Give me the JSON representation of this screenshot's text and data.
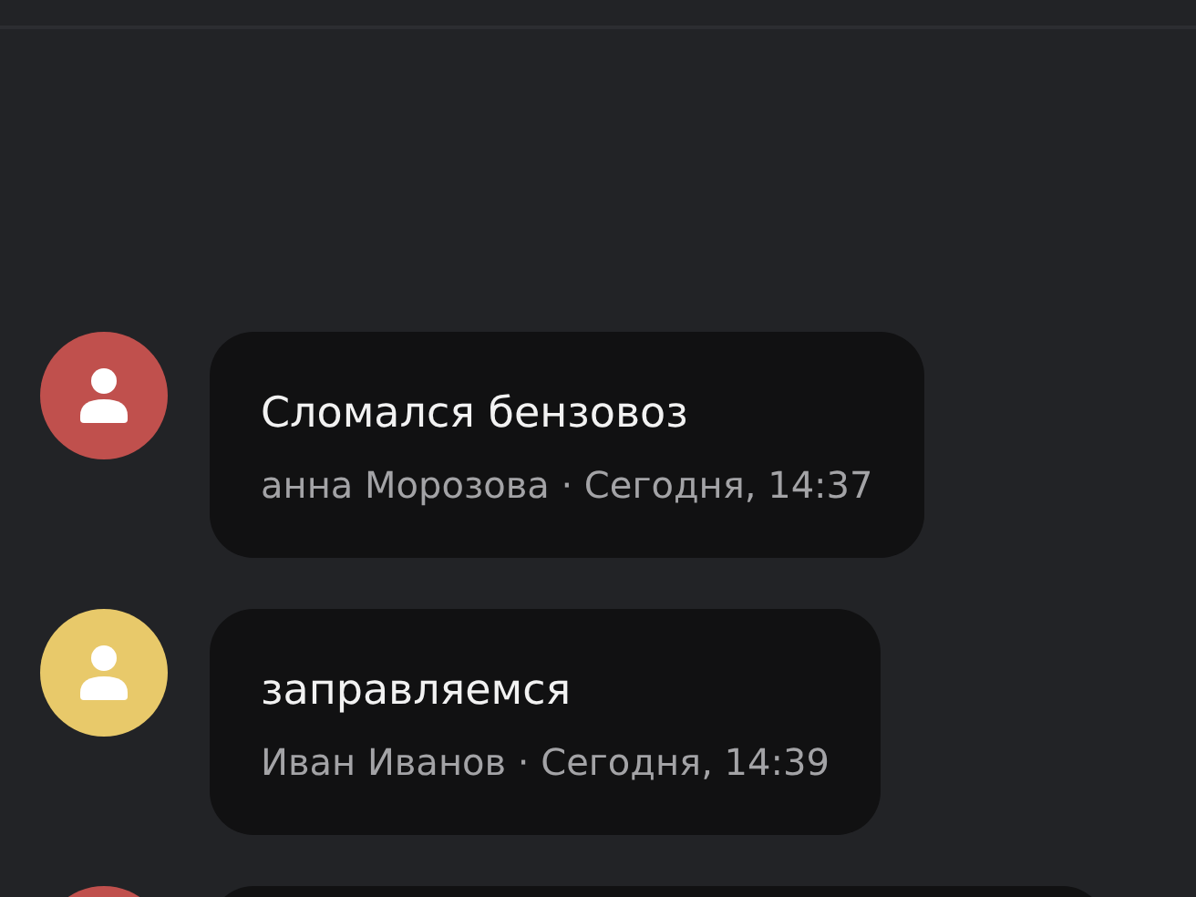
{
  "messages": [
    {
      "color": "#c0504d",
      "text": "Сломался бензовоз",
      "meta": "анна Морозова · Сегодня, 14:37"
    },
    {
      "color": "#e8c96a",
      "text": "заправляемся",
      "meta": "Иван Иванов · Сегодня, 14:39"
    },
    {
      "color": "#c0504d"
    }
  ]
}
